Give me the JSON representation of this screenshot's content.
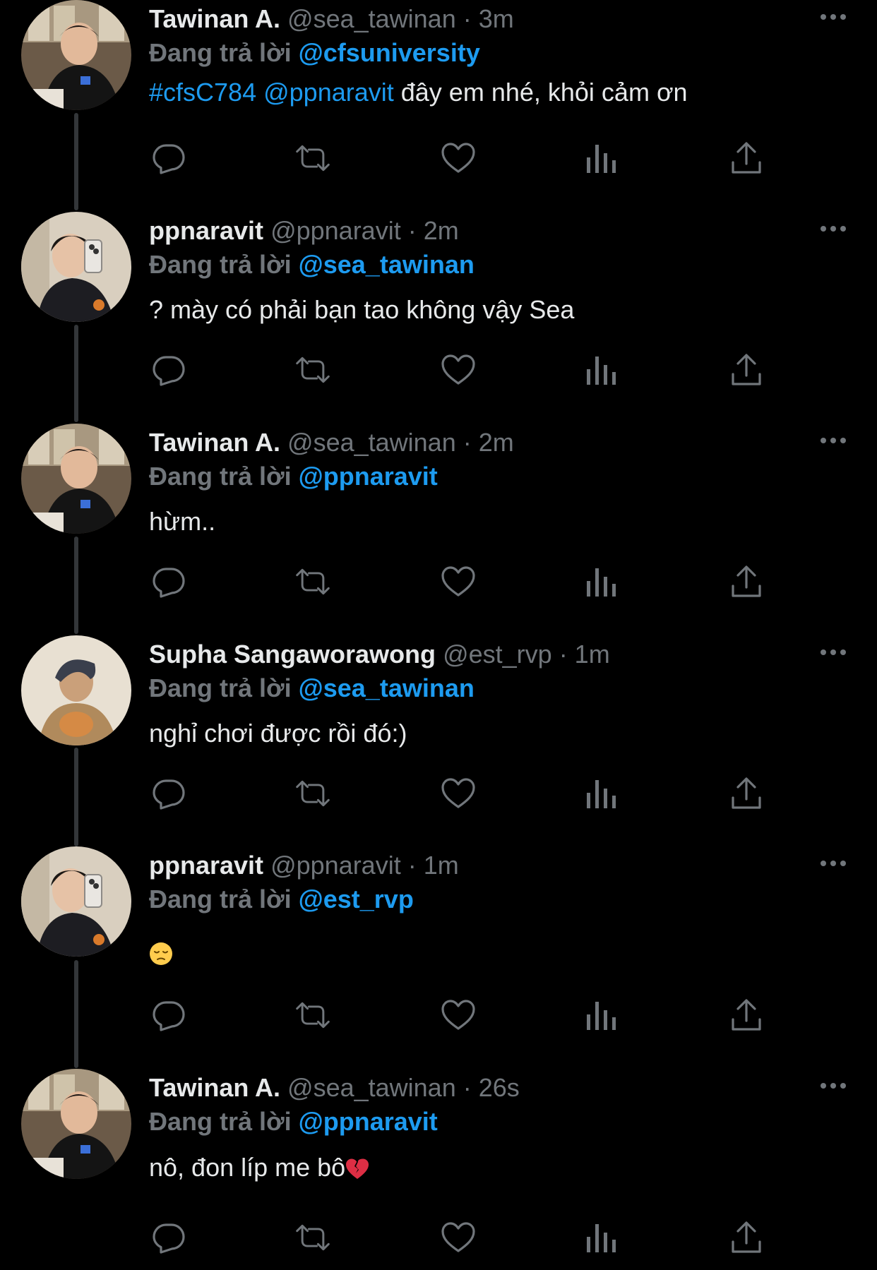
{
  "thread": {
    "reply_label": "Đang trả lời",
    "action_icons": [
      "reply-icon",
      "retweet-icon",
      "like-icon",
      "views-icon",
      "share-icon"
    ],
    "more_icon": "more-icon",
    "tweets": [
      {
        "name": "Tawinan A.",
        "handle": "@sea_tawinan",
        "time": "· 3m",
        "reply_to": "@cfsuniversity",
        "hashtag": "#cfsC784",
        "mention": "@ppnaravit",
        "text": "đây em nhé, khỏi cảm ơn",
        "avatar": "avatar-tawinan"
      },
      {
        "name": "ppnaravit",
        "handle": "@ppnaravit",
        "time": "· 2m",
        "reply_to": "@sea_tawinan",
        "text": "? mày có phải bạn tao không vậy Sea",
        "avatar": "avatar-ppnaravit"
      },
      {
        "name": "Tawinan A.",
        "handle": "@sea_tawinan",
        "time": "· 2m",
        "reply_to": "@ppnaravit",
        "text": "hừm..",
        "avatar": "avatar-tawinan"
      },
      {
        "name": "Supha Sangaworawong",
        "handle": "@est_rvp",
        "time": "· 1m",
        "reply_to": "@sea_tawinan",
        "text": "nghỉ chơi được rồi đó:)",
        "avatar": "avatar-supha"
      },
      {
        "name": "ppnaravit",
        "handle": "@ppnaravit",
        "time": "· 1m",
        "reply_to": "@est_rvp",
        "text": "",
        "emoji": "pensive-face-emoji",
        "avatar": "avatar-ppnaravit"
      },
      {
        "name": "Tawinan A.",
        "handle": "@sea_tawinan",
        "time": "· 26s",
        "reply_to": "@ppnaravit",
        "text": "nô, đon líp me bô",
        "emoji": "broken-heart-emoji",
        "avatar": "avatar-tawinan"
      }
    ]
  },
  "colors": {
    "background": "#000000",
    "text_primary": "#e7e9ea",
    "text_secondary": "#71767b",
    "accent": "#1d9bf0",
    "thread_line": "#333639"
  }
}
